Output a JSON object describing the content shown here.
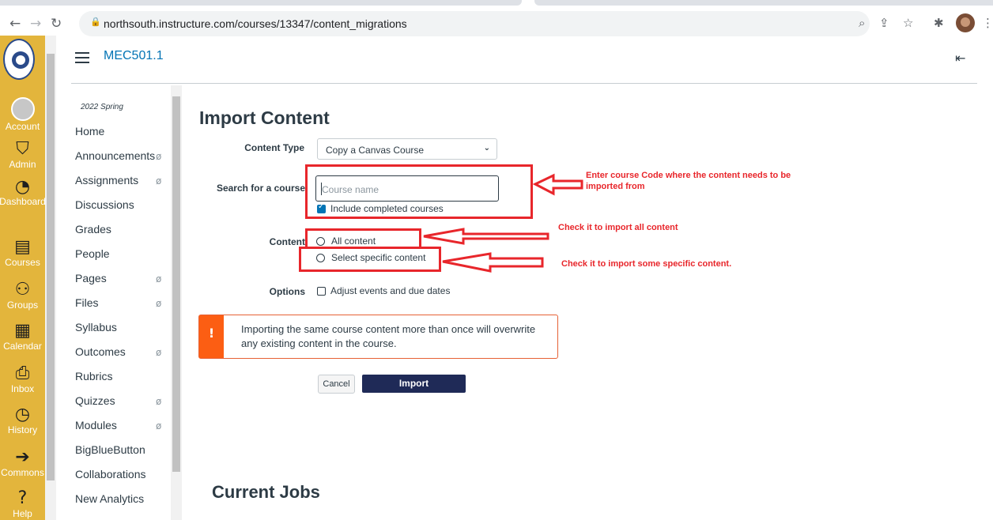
{
  "browser": {
    "url": "northsouth.instructure.com/courses/13347/content_migrations"
  },
  "global_nav": {
    "items": [
      {
        "label": "Account",
        "icon": "avatar"
      },
      {
        "label": "Admin",
        "icon": "shield-icon"
      },
      {
        "label": "Dashboard",
        "icon": "dashboard-icon"
      },
      {
        "label": "Courses",
        "icon": "book-icon"
      },
      {
        "label": "Groups",
        "icon": "groups-icon"
      },
      {
        "label": "Calendar",
        "icon": "calendar-icon"
      },
      {
        "label": "Inbox",
        "icon": "inbox-icon"
      },
      {
        "label": "History",
        "icon": "clock-icon"
      },
      {
        "label": "Commons",
        "icon": "commons-icon"
      },
      {
        "label": "Help",
        "icon": "help-icon"
      }
    ]
  },
  "header": {
    "course_title": "MEC501.1"
  },
  "course_nav": {
    "term": "2022 Spring",
    "items": [
      {
        "label": "Home",
        "hidden": false
      },
      {
        "label": "Announcements",
        "hidden": true
      },
      {
        "label": "Assignments",
        "hidden": true
      },
      {
        "label": "Discussions",
        "hidden": false
      },
      {
        "label": "Grades",
        "hidden": false
      },
      {
        "label": "People",
        "hidden": false
      },
      {
        "label": "Pages",
        "hidden": true
      },
      {
        "label": "Files",
        "hidden": true
      },
      {
        "label": "Syllabus",
        "hidden": false
      },
      {
        "label": "Outcomes",
        "hidden": true
      },
      {
        "label": "Rubrics",
        "hidden": false
      },
      {
        "label": "Quizzes",
        "hidden": true
      },
      {
        "label": "Modules",
        "hidden": true
      },
      {
        "label": "BigBlueButton",
        "hidden": false
      },
      {
        "label": "Collaborations",
        "hidden": false
      },
      {
        "label": "New Analytics",
        "hidden": false
      }
    ]
  },
  "main": {
    "title": "Import Content",
    "content_type_label": "Content Type",
    "content_type_value": "Copy a Canvas Course",
    "search_label": "Search for a course",
    "search_placeholder": "Course name",
    "include_completed_label": "Include completed courses",
    "include_completed_checked": true,
    "content_label": "Content",
    "content_options": [
      "All content",
      "Select specific content"
    ],
    "options_label": "Options",
    "adjust_dates_label": "Adjust events and due dates",
    "alert_icon": "!",
    "alert_text": "Importing the same course content more than once will overwrite any existing content in the course.",
    "cancel_label": "Cancel",
    "import_label": "Import",
    "current_jobs_title": "Current Jobs"
  },
  "annotations": {
    "note_search": "Enter course Code  where the content needs to be imported from",
    "note_all": "Check it to  import all content",
    "note_specific": "Check it to import some specific content."
  },
  "colors": {
    "global_nav_bg": "#e3b53c",
    "link": "#0374b5",
    "import_button": "#1f2a57",
    "alert_accent": "#fc5e13",
    "annotation_red": "#e8262b"
  }
}
